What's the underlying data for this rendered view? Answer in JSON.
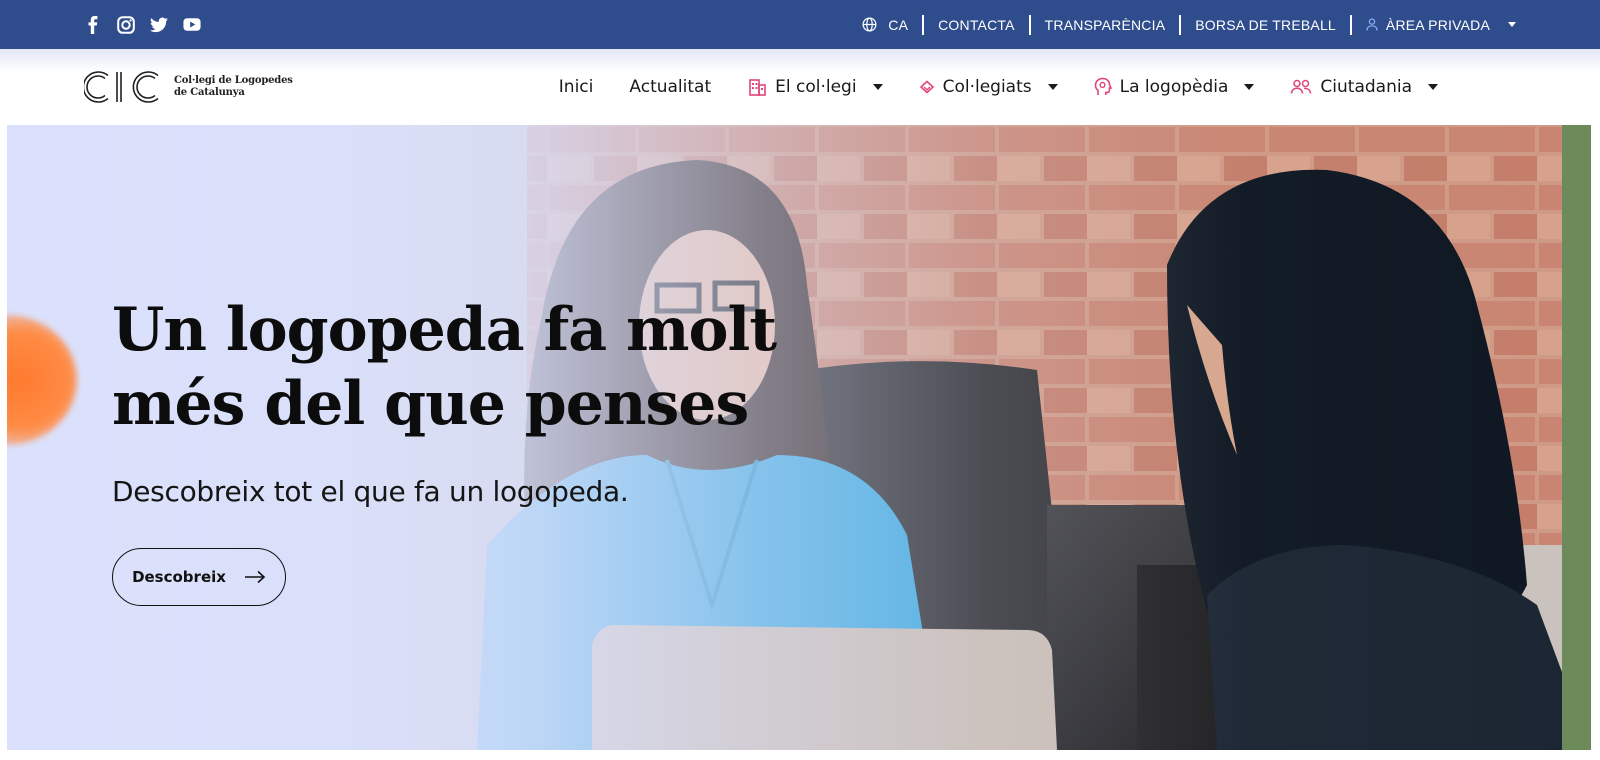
{
  "topbar": {
    "background": "#2f4d8c",
    "social": [
      {
        "icon": "facebook-icon"
      },
      {
        "icon": "instagram-icon"
      },
      {
        "icon": "twitter-icon"
      },
      {
        "icon": "youtube-icon"
      }
    ],
    "language": "CA",
    "links": {
      "contact": "CONTACTA",
      "transparency": "TRANSPARÈNCIA",
      "jobs": "BORSA DE TREBALL",
      "private_area": "ÀREA PRIVADA"
    }
  },
  "brand": {
    "logo_text": "CIC",
    "name_line1": "Col·legi de Logopedes",
    "name_line2": "de Catalunya"
  },
  "nav": {
    "items": [
      {
        "label": "Inici"
      },
      {
        "label": "Actualitat"
      },
      {
        "label": "El col·legi",
        "icon": "building-icon"
      },
      {
        "label": "Col·legiats",
        "icon": "diamond-icon"
      },
      {
        "label": "La logopèdia",
        "icon": "head-icon"
      },
      {
        "label": "Ciutadania",
        "icon": "people-icon"
      }
    ],
    "accent_color": "#e0457b"
  },
  "hero": {
    "title_line1": "Un logopeda fa molt",
    "title_line2": "més del que penses",
    "subtitle": "Descobreix tot el que fa un logopeda.",
    "button_label": "Descobreix",
    "button_icon": "arrow-right-icon"
  }
}
